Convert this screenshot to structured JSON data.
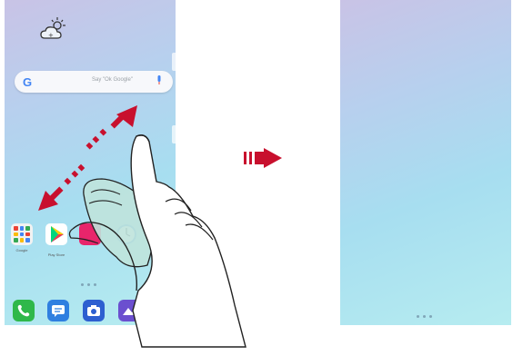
{
  "left_screen": {
    "search": {
      "brand": "G",
      "placeholder": "Say \"Ok Google\""
    },
    "apps": [
      {
        "name": "Google",
        "icon": "google-folder-icon",
        "color": "#f2f2f2"
      },
      {
        "name": "Play Store",
        "icon": "play-store-icon",
        "color": "#ffffff"
      },
      {
        "name": "",
        "icon": "app-icon",
        "color": "#e8256b"
      },
      {
        "name": "",
        "icon": "clock-icon",
        "color": "#5aa2e8"
      }
    ],
    "dock": [
      {
        "icon": "phone-icon",
        "color": "#2fb84a"
      },
      {
        "icon": "messages-icon",
        "color": "#2f7fe0"
      },
      {
        "icon": "camera-icon",
        "color": "#2d5fd0"
      },
      {
        "icon": "gallery-icon",
        "color": "#6b4fcf"
      }
    ]
  },
  "colors": {
    "arrow": "#c8102e",
    "hand_fill": "#bfe3dc"
  }
}
